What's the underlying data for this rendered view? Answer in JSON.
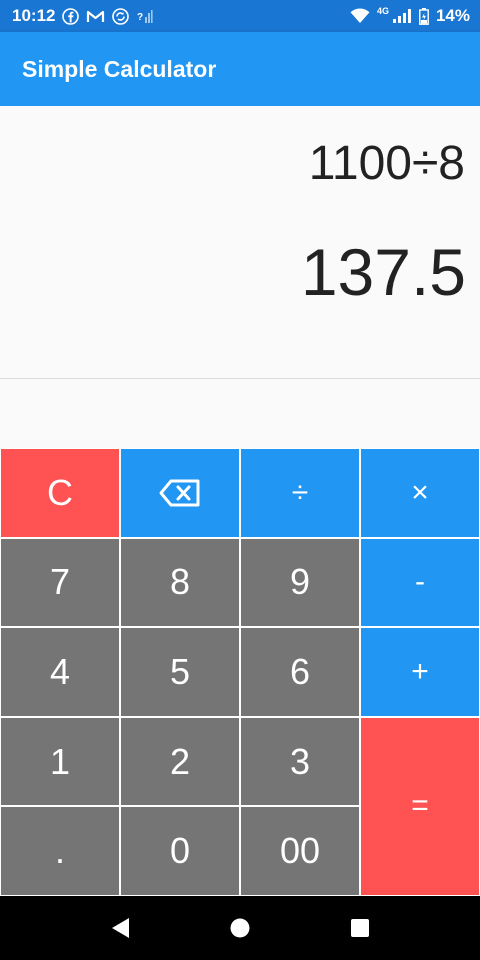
{
  "status_bar": {
    "time": "10:12",
    "network_label": "4G",
    "battery": "14%",
    "icons": [
      "facebook-icon",
      "gmail-icon",
      "sync-icon",
      "no-signal-icon",
      "wifi-icon",
      "cell-signal-icon",
      "battery-icon"
    ]
  },
  "app_bar": {
    "title": "Simple Calculator"
  },
  "display": {
    "expression": "1100÷8",
    "result": "137.5"
  },
  "keypad": {
    "clear": "C",
    "backspace_icon": "backspace-icon",
    "divide": "÷",
    "multiply": "×",
    "seven": "7",
    "eight": "8",
    "nine": "9",
    "minus": "-",
    "four": "4",
    "five": "5",
    "six": "6",
    "plus": "+",
    "one": "1",
    "two": "2",
    "three": "3",
    "equals": "=",
    "dot": ".",
    "zero": "0",
    "double_zero": "00"
  },
  "nav_bar": {
    "icons": [
      "back-icon",
      "home-icon",
      "recents-icon"
    ]
  },
  "colors": {
    "status_bar": "#1976d2",
    "app_bar": "#2196f3",
    "operator_key": "#2196f3",
    "number_key": "#757575",
    "accent_red": "#ff5252",
    "display_bg": "#fafafa"
  }
}
